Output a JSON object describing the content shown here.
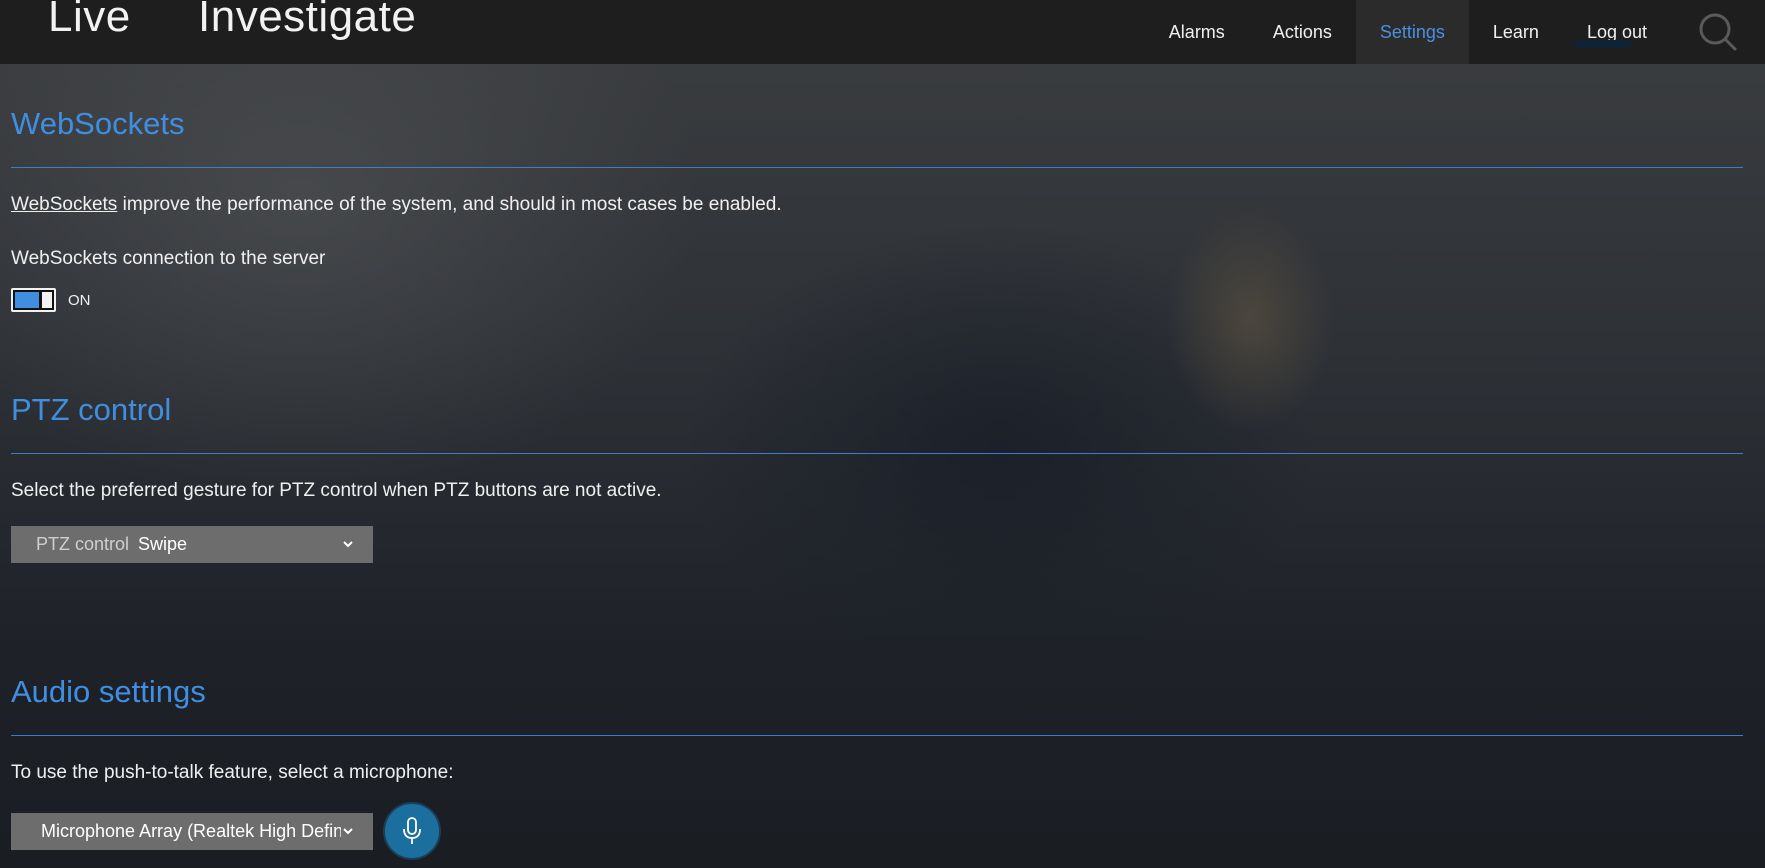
{
  "header": {
    "brand_links": [
      "Live",
      "Investigate"
    ],
    "nav": {
      "alarms": "Alarms",
      "actions": "Actions",
      "settings": "Settings",
      "learn": "Learn",
      "logout": "Log out"
    },
    "active_nav": "Settings"
  },
  "websockets": {
    "title": "WebSockets",
    "link_text": "WebSockets",
    "description_rest": " improve the performance of the system, and should in most cases be enabled.",
    "connection_label": "WebSockets connection to the server",
    "toggle_state": "ON"
  },
  "ptz": {
    "title": "PTZ control",
    "description": "Select the preferred gesture for PTZ control when PTZ buttons are not active.",
    "select_label": "PTZ control",
    "select_value": "Swipe"
  },
  "audio": {
    "title": "Audio settings",
    "description": "To use the push-to-talk feature, select a microphone:",
    "microphone_value": "Microphone Array (Realtek High Defin..."
  },
  "colors": {
    "accent": "#3f8ee0",
    "header_bg": "#1e1e1e",
    "select_bg": "#6d6d6d",
    "mic_button": "#1a6f9e"
  },
  "icons": {
    "search": "search-icon",
    "chevron": "chevron-down-icon",
    "microphone": "microphone-icon"
  }
}
